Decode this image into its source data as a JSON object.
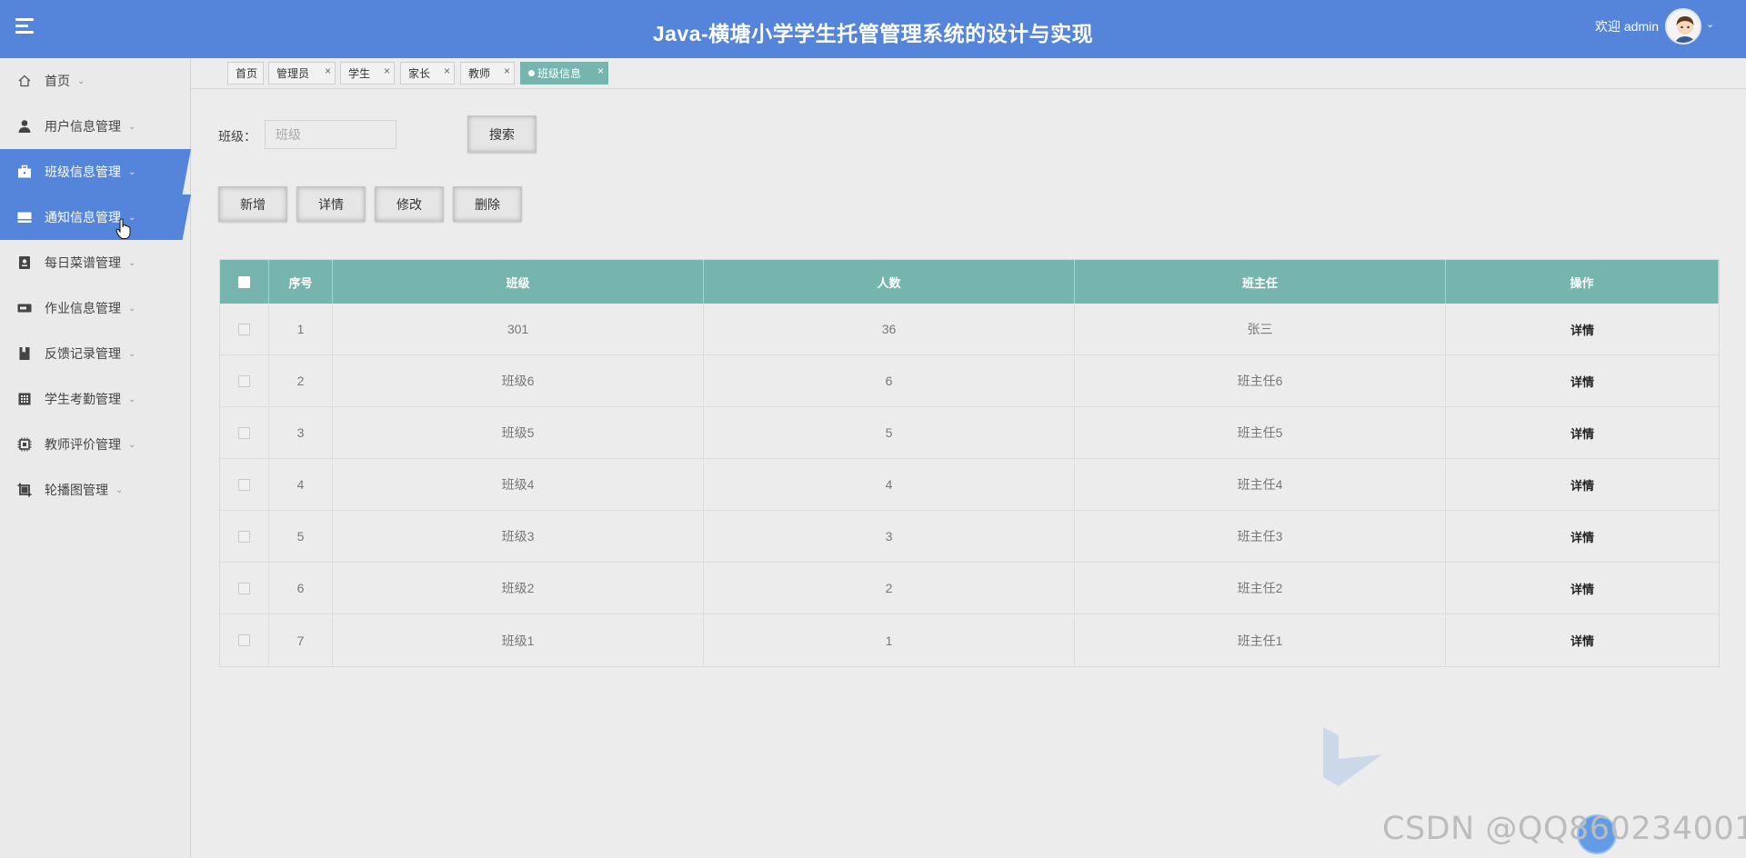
{
  "header": {
    "title": "Java-横塘小学学生托管管理系统的设计与实现",
    "welcome": "欢迎 admin"
  },
  "sidebar": {
    "items": [
      {
        "label": "首页",
        "icon": "home-icon"
      },
      {
        "label": "用户信息管理",
        "icon": "user-icon"
      },
      {
        "label": "班级信息管理",
        "icon": "briefcase-icon",
        "active": true
      },
      {
        "label": "通知信息管理",
        "icon": "monitor-icon",
        "active": true
      },
      {
        "label": "每日菜谱管理",
        "icon": "menu-book-icon"
      },
      {
        "label": "作业信息管理",
        "icon": "toggle-icon"
      },
      {
        "label": "反馈记录管理",
        "icon": "bookmark-icon"
      },
      {
        "label": "学生考勤管理",
        "icon": "calendar-grid-icon"
      },
      {
        "label": "教师评价管理",
        "icon": "chip-icon"
      },
      {
        "label": "轮播图管理",
        "icon": "crop-icon"
      }
    ]
  },
  "tabs": [
    {
      "label": "首页"
    },
    {
      "label": "管理员",
      "close": "×"
    },
    {
      "label": "学生",
      "close": "×"
    },
    {
      "label": "家长",
      "close": "×"
    },
    {
      "label": "教师",
      "close": "×"
    },
    {
      "label": "班级信息",
      "close": "×",
      "active": true
    }
  ],
  "search": {
    "label": "班级：",
    "placeholder": "班级",
    "button": "搜索"
  },
  "actions": {
    "add": "新增",
    "detail": "详情",
    "edit": "修改",
    "delete": "删除"
  },
  "table": {
    "columns": [
      "序号",
      "班级",
      "人数",
      "班主任",
      "操作"
    ],
    "rows": [
      {
        "idx": "1",
        "class": "301",
        "count": "36",
        "teacher": "张三",
        "op": "详情"
      },
      {
        "idx": "2",
        "class": "班级6",
        "count": "6",
        "teacher": "班主任6",
        "op": "详情"
      },
      {
        "idx": "3",
        "class": "班级5",
        "count": "5",
        "teacher": "班主任5",
        "op": "详情"
      },
      {
        "idx": "4",
        "class": "班级4",
        "count": "4",
        "teacher": "班主任4",
        "op": "详情"
      },
      {
        "idx": "5",
        "class": "班级3",
        "count": "3",
        "teacher": "班主任3",
        "op": "详情"
      },
      {
        "idx": "6",
        "class": "班级2",
        "count": "2",
        "teacher": "班主任2",
        "op": "详情"
      },
      {
        "idx": "7",
        "class": "班级1",
        "count": "1",
        "teacher": "班主任1",
        "op": "详情"
      }
    ]
  },
  "watermark": "CSDN @QQ860234001",
  "colors": {
    "header": "#5485db",
    "table_header": "#76b5ad",
    "active_tab": "#76b5ad"
  }
}
